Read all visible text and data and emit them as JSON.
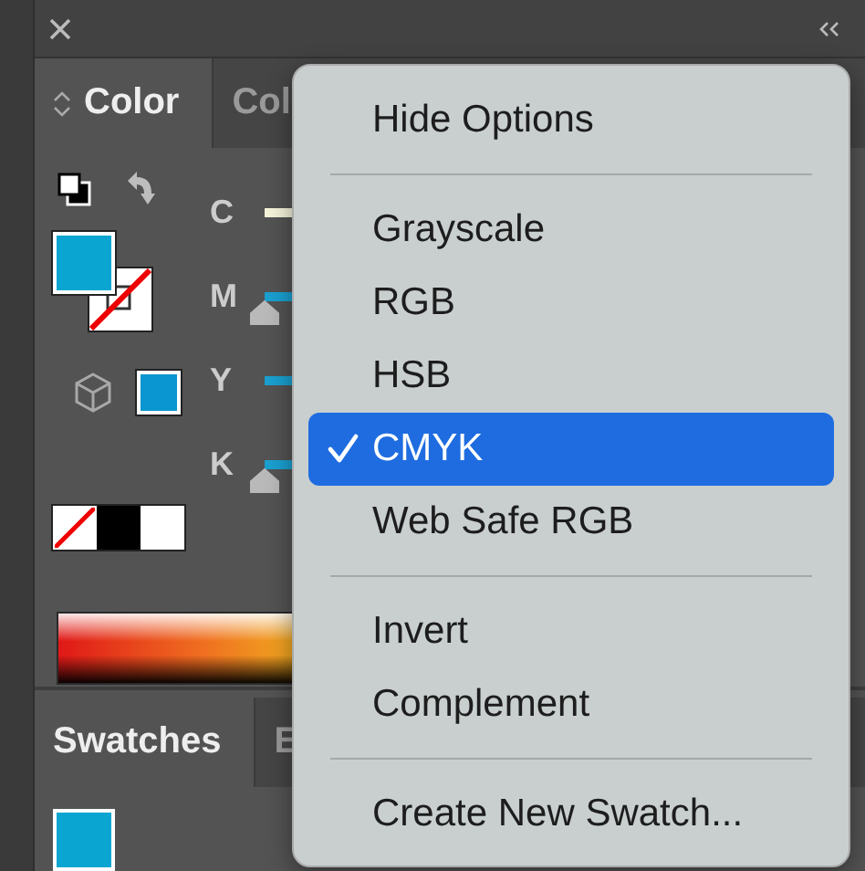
{
  "color_panel": {
    "tabs": [
      {
        "label": "Color",
        "selected": true
      },
      {
        "label": "Col",
        "selected": false
      }
    ],
    "channels": [
      {
        "label": "C"
      },
      {
        "label": "M",
        "level": 0
      },
      {
        "label": "Y"
      },
      {
        "label": "K",
        "level": 0
      }
    ]
  },
  "swatches_panel": {
    "tabs": [
      {
        "label": "Swatches",
        "selected": true
      },
      {
        "label": "E",
        "selected": false
      }
    ]
  },
  "menu": {
    "items": [
      {
        "kind": "item",
        "label": "Hide Options",
        "selected": false
      },
      {
        "kind": "separator"
      },
      {
        "kind": "item",
        "label": "Grayscale",
        "selected": false
      },
      {
        "kind": "item",
        "label": "RGB",
        "selected": false
      },
      {
        "kind": "item",
        "label": "HSB",
        "selected": false
      },
      {
        "kind": "item",
        "label": "CMYK",
        "selected": true
      },
      {
        "kind": "item",
        "label": "Web Safe RGB",
        "selected": false
      },
      {
        "kind": "separator"
      },
      {
        "kind": "item",
        "label": "Invert",
        "selected": false
      },
      {
        "kind": "item",
        "label": "Complement",
        "selected": false
      },
      {
        "kind": "separator"
      },
      {
        "kind": "item",
        "label": "Create New Swatch...",
        "selected": false
      }
    ]
  }
}
